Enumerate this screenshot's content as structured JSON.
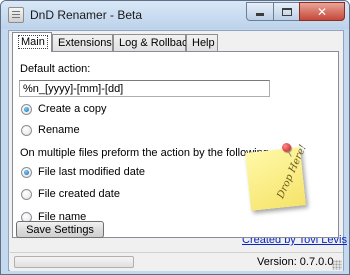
{
  "window": {
    "title": "DnD Renamer - Beta",
    "close_glyph": "✕"
  },
  "tabs": [
    {
      "label": "Main",
      "active": true
    },
    {
      "label": "Extensions",
      "active": false
    },
    {
      "label": "Log & Rollback",
      "active": false
    },
    {
      "label": "Help",
      "active": false
    }
  ],
  "main": {
    "default_action_label": "Default action:",
    "default_action_value": "%n_[yyyy]-[mm]-[dd]",
    "action_options": [
      {
        "label": "Create a copy",
        "selected": true
      },
      {
        "label": "Rename",
        "selected": false
      }
    ],
    "order_label": "On multiple files preform the action by the following order:",
    "order_options": [
      {
        "label": "File last modified date",
        "selected": true
      },
      {
        "label": "File created date",
        "selected": false
      },
      {
        "label": "File name",
        "selected": false
      }
    ],
    "drop_note": "Drop Here!",
    "save_button": "Save Settings",
    "credit_link": "Created by Tovi Levis"
  },
  "status": {
    "progress": 0,
    "version": "Version: 0.7.0.0"
  },
  "colors": {
    "accent": "#1562a8",
    "link": "#0a24c2",
    "sticky_note": "#fff9a8",
    "pin": "#c0120f"
  }
}
